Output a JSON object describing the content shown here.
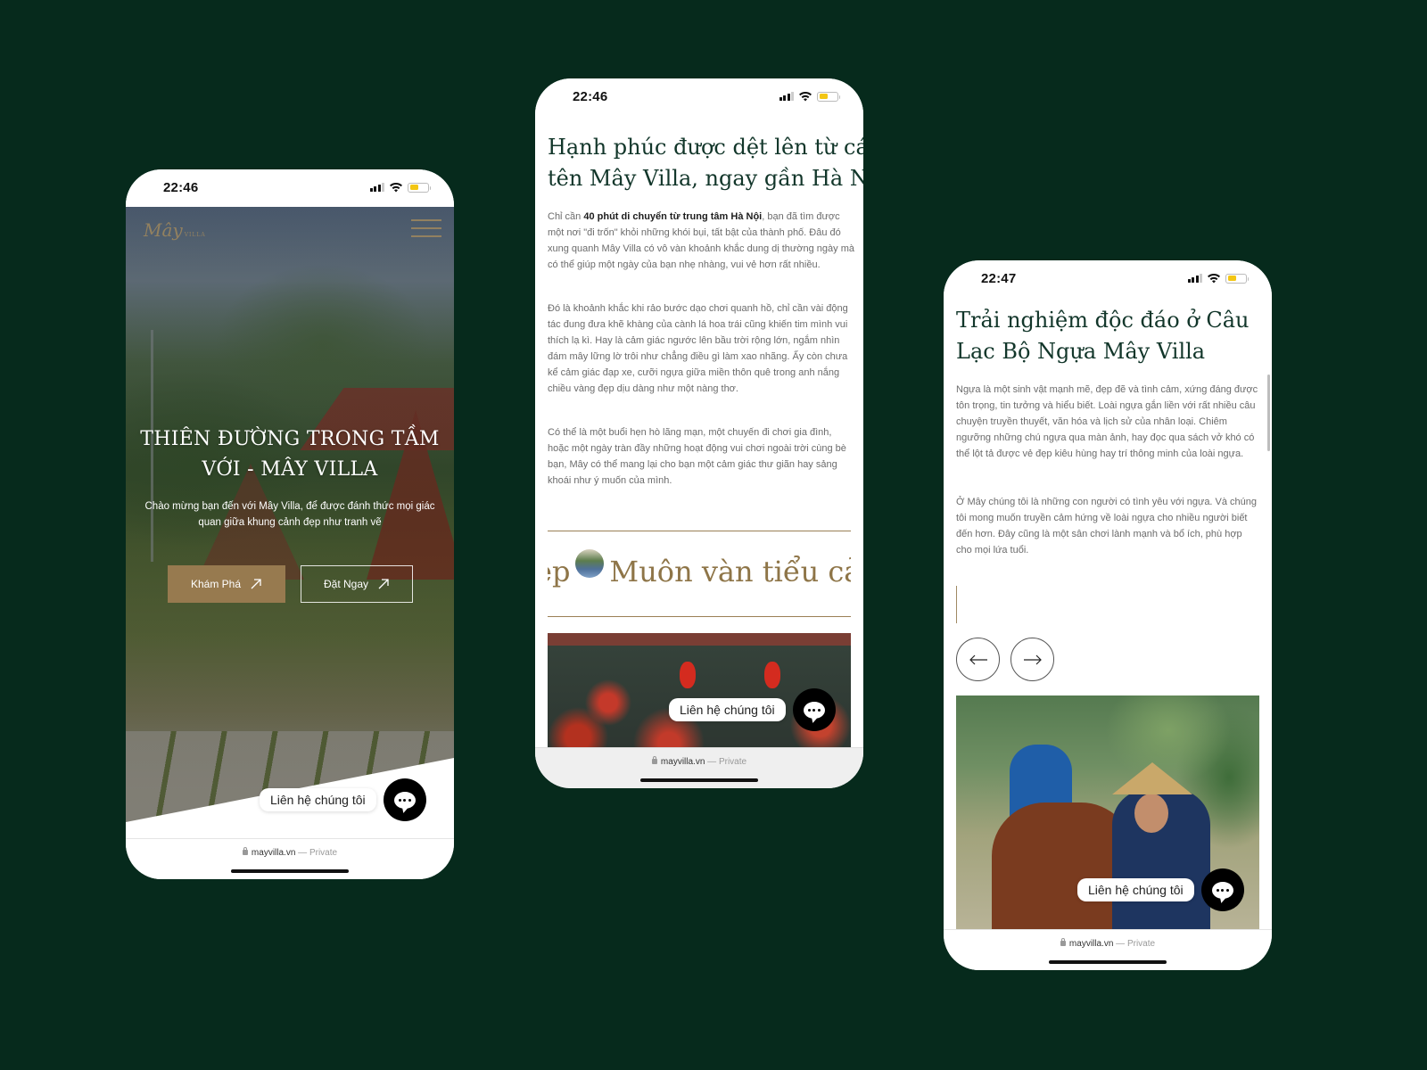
{
  "colors": {
    "background": "#062a1c",
    "gold": "#977a4f",
    "heading_green": "#12362a",
    "battery_yellow": "#f3c614"
  },
  "phones": [
    {
      "status_time": "22:46",
      "logo": {
        "text": "Mây",
        "sub": "VILLA"
      },
      "menu_icon": "hamburger-icon",
      "hero": {
        "title_line1": "THIÊN ĐƯỜNG TRONG TẦM",
        "title_line2": "VỚI - MÂY VILLA",
        "subtitle": "Chào mừng bạn đến với Mây Villa, để được đánh thức mọi giác quan giữa khung cảnh đẹp như tranh vẽ",
        "primary_button": "Khám Phá",
        "secondary_button": "Đặt Ngay"
      },
      "contact_label": "Liên hệ chúng tôi",
      "url": {
        "domain": "mayvilla.vn",
        "suffix": "— Private"
      }
    },
    {
      "status_time": "22:46",
      "heading_line1": "Hạnh phúc được dệt lên từ cái",
      "heading_line2": "tên Mây Villa, ngay gần Hà Nội",
      "paragraph1": {
        "prefix": "Chỉ cần ",
        "bold": "40 phút di chuyển từ trung tâm Hà Nội",
        "rest": ", bạn đã tìm được một nơi \"đi trốn\" khỏi những khói bụi, tất bật của thành phố. Đâu đó xung quanh Mây Villa có vô vàn khoảnh khắc dung dị thường ngày mà có thể giúp một ngày của bạn nhẹ nhàng, vui vẻ hơn rất nhiều."
      },
      "paragraph2": "Đó là khoảnh khắc khi rảo bước dạo chơi quanh hồ, chỉ cần vài động tác đung đưa khẽ khàng của cành lá hoa trái cũng khiến tim mình vui thích lạ kì. Hay là cảm giác ngước lên bầu trời rộng lớn, ngắm nhìn đám mây lững lờ trôi như chẳng điều gì làm xao nhãng. Ấy còn chưa kể cảm giác đạp xe, cưỡi ngựa giữa miền thôn quê trong anh nắng chiều vàng đẹp dịu dàng như một nàng thơ.",
      "paragraph3": "Có thể là một buổi hẹn hò lãng mạn, một chuyến đi chơi gia đình, hoặc một ngày tràn đầy những hoạt động vui chơi ngoài trời cùng bè bạn, Mây có thể mang lại cho bạn một cảm giác thư giãn hay sảng khoái như ý muốn của mình.",
      "marquee": {
        "before": "ẹp",
        "after": "Muôn vàn tiểu cảnh"
      },
      "contact_label": "Liên hệ chúng tôi",
      "url": {
        "domain": "mayvilla.vn",
        "suffix": "— Private"
      }
    },
    {
      "status_time": "22:47",
      "heading_line1": "Trải nghiệm độc đáo ở Câu",
      "heading_line2": "Lạc Bộ Ngựa Mây Villa",
      "paragraph1": "Ngựa là một sinh vật mạnh mẽ, đẹp đẽ và tình cảm, xứng đáng được tôn trọng, tin tưởng và hiểu biết. Loài ngựa gắn liền với rất nhiều câu chuyện truyền thuyết, văn hóa và lịch sử của nhân loại. Chiêm ngưỡng những chú ngựa qua màn ảnh, hay đọc qua sách vở khó có thể lột tả được vẻ đẹp kiêu hùng hay trí thông minh của loài ngựa.",
      "paragraph2": "Ở Mây chúng tôi là những con người có tình yêu với ngựa. Và chúng tôi mong muốn truyền cảm hứng về loài ngựa cho nhiều người biết đến hơn. Đây cũng là một sân chơi lành mạnh và bổ ích, phù hợp cho mọi lứa tuổi.",
      "prev_icon": "arrow-left-icon",
      "next_icon": "arrow-right-icon",
      "contact_label": "Liên hệ chúng tôi",
      "url": {
        "domain": "mayvilla.vn",
        "suffix": "— Private"
      }
    }
  ]
}
